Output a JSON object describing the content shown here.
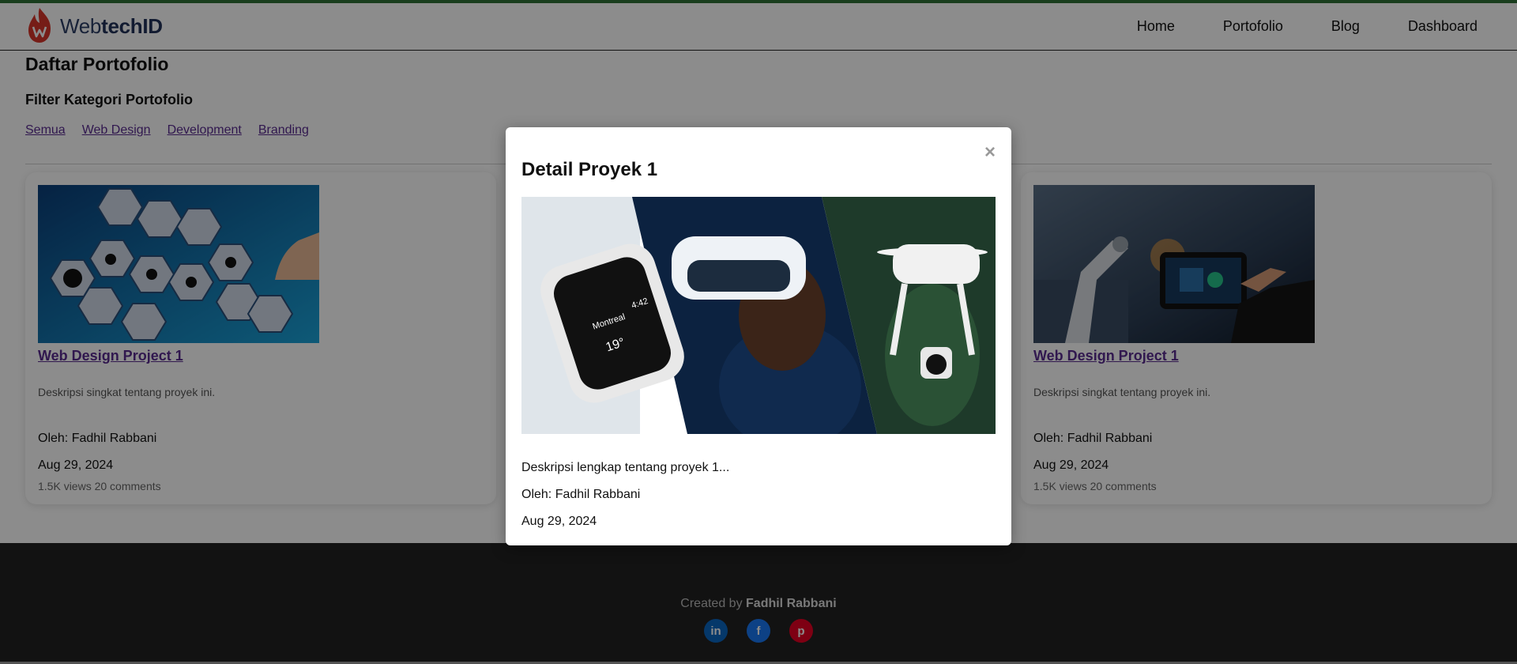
{
  "header": {
    "logo_prefix": "Web",
    "logo_suffix": "techID",
    "nav": [
      "Home",
      "Portofolio",
      "Blog",
      "Dashboard"
    ]
  },
  "page": {
    "title": "Daftar Portofolio",
    "filter_title": "Filter Kategori Portofolio",
    "filters": [
      "Semua",
      "Web Design",
      "Development",
      "Branding"
    ]
  },
  "cards": [
    {
      "title": "Web Design Project 1",
      "description": "Deskripsi singkat tentang proyek ini.",
      "author": "Oleh: Fadhil Rabbani",
      "date": "Aug 29, 2024",
      "stats": "1.5K views 20 comments"
    },
    {
      "title": "Web Design Project 1",
      "description": "Deskripsi singkat tentang proyek ini.",
      "author": "Oleh: Fadhil Rabbani",
      "date": "Aug 29, 2024",
      "stats": "1.5K views 20 comments"
    }
  ],
  "modal": {
    "close": "×",
    "title": "Detail Proyek 1",
    "description": "Deskripsi lengkap tentang proyek 1...",
    "author": "Oleh: Fadhil Rabbani",
    "date": "Aug 29, 2024",
    "watch_city": "Montreal",
    "watch_time": "4:42",
    "watch_temp": "19°"
  },
  "footer": {
    "credit_prefix": "Created by",
    "credit_name": "Fadhil Rabbani",
    "social_icons": [
      "linkedin-icon",
      "facebook-icon",
      "pinterest-icon"
    ],
    "linkedin_glyph": "in",
    "facebook_glyph": "f",
    "pinterest_glyph": "p"
  },
  "colors": {
    "link_purple": "#5a2d91",
    "footer_bg": "#222222",
    "top_accent": "#2f6f36",
    "overlay": "rgba(0,0,0,0.45)"
  }
}
